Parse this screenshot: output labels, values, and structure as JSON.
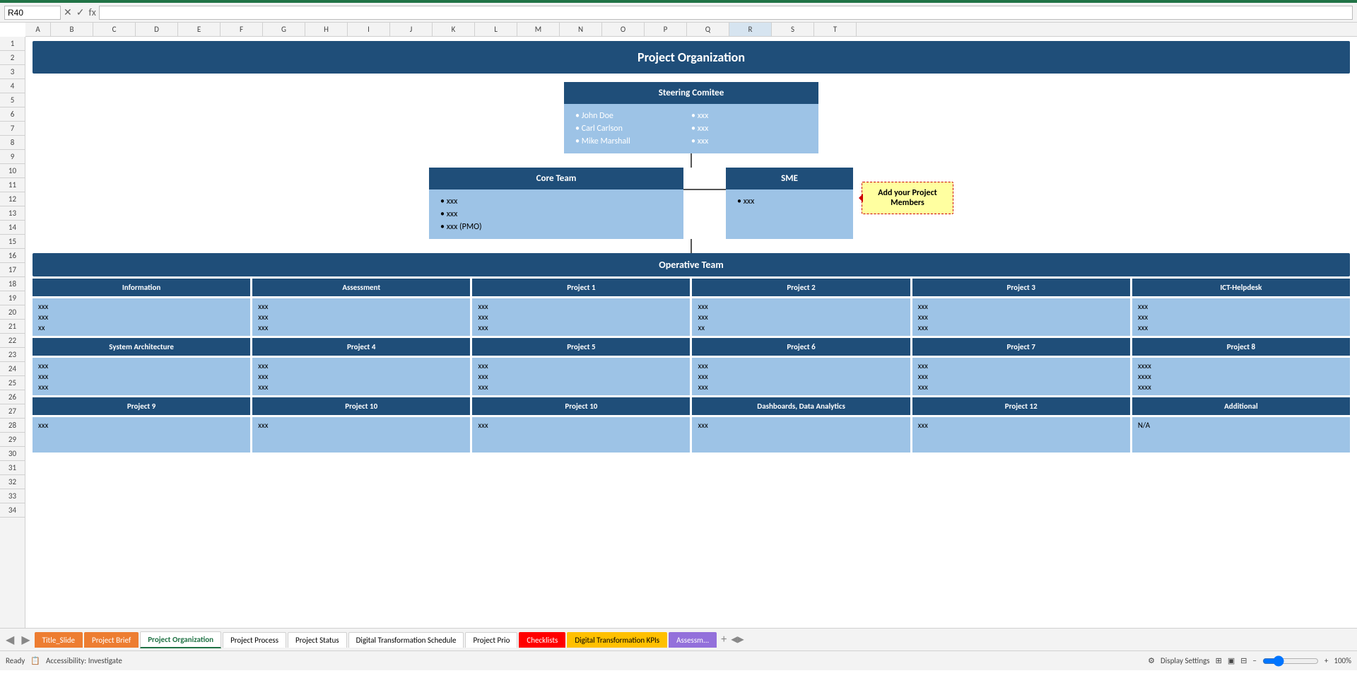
{
  "topBar": {
    "cellRef": "R40",
    "cancelIcon": "✕",
    "confirmIcon": "✓",
    "formulaIcon": "fx"
  },
  "mainHeader": "Project Organization",
  "steeringCommittee": {
    "title": "Steering Comitee",
    "leftMembers": [
      "John Doe",
      "Carl Carlson",
      "Mike Marshall"
    ],
    "rightMembers": [
      "xxx",
      "xxx",
      "xxx"
    ]
  },
  "coreTeam": {
    "title": "Core Team",
    "members": [
      "xxx",
      "xxx",
      "xxx (PMO)"
    ]
  },
  "sme": {
    "title": "SME",
    "members": [
      "xxx"
    ]
  },
  "callout": "Add your Project Members",
  "operativeTeam": {
    "title": "Operative Team"
  },
  "columns": [
    {
      "header": "Information",
      "rows": [
        {
          "items": [
            "xxx",
            "xxx",
            "xx"
          ]
        },
        {
          "header": "System Architecture",
          "items": [
            "xxx",
            "xxx",
            "xxx"
          ]
        },
        {
          "header": "Project 9",
          "items": [
            "xxx"
          ]
        }
      ]
    },
    {
      "header": "Assessment",
      "rows": [
        {
          "items": [
            "xxx",
            "xxx",
            "xxx"
          ]
        },
        {
          "header": "Project 4",
          "items": [
            "xxx",
            "xxx",
            "xxx"
          ]
        },
        {
          "header": "Project 10",
          "items": [
            "xxx"
          ]
        }
      ]
    },
    {
      "header": "Project 1",
      "rows": [
        {
          "items": [
            "xxx",
            "xxx",
            "xxx"
          ]
        },
        {
          "header": "Project 5",
          "items": [
            "xxx",
            "xxx",
            "xxx"
          ]
        },
        {
          "header": "Project 10",
          "items": [
            "xxx"
          ]
        }
      ]
    },
    {
      "header": "Project 2",
      "rows": [
        {
          "items": [
            "xxx",
            "xxx",
            "xx"
          ]
        },
        {
          "header": "Project 6",
          "items": [
            "xxx",
            "xxx",
            "xxx"
          ]
        },
        {
          "header": "Dashboards, Data Analytics",
          "items": [
            "xxx"
          ]
        }
      ]
    },
    {
      "header": "Project 3",
      "rows": [
        {
          "items": [
            "xxx",
            "xxx",
            "xxx"
          ]
        },
        {
          "header": "Project 7",
          "items": [
            "xxx",
            "xxx",
            "xxx"
          ]
        },
        {
          "header": "Project 12",
          "items": [
            "xxx"
          ]
        }
      ]
    },
    {
      "header": "ICT-Helpdesk",
      "rows": [
        {
          "items": [
            "xxx",
            "xxx",
            "xxx"
          ]
        },
        {
          "header": "Project 8",
          "items": [
            "xxxx",
            "xxxx",
            "xxxx"
          ]
        },
        {
          "header": "Additional",
          "items": [
            "N/A"
          ]
        }
      ]
    }
  ],
  "tabs": [
    {
      "label": "Title_Slide",
      "style": "orange"
    },
    {
      "label": "Project Brief",
      "style": "orange"
    },
    {
      "label": "Project Organization",
      "style": "green"
    },
    {
      "label": "Project Process",
      "style": "default"
    },
    {
      "label": "Project Status",
      "style": "default"
    },
    {
      "label": "Digital Transformation Schedule",
      "style": "default"
    },
    {
      "label": "Project Prio",
      "style": "default"
    },
    {
      "label": "Checklists",
      "style": "red"
    },
    {
      "label": "Digital Transformation KPIs",
      "style": "gold"
    },
    {
      "label": "Assessm...",
      "style": "purple"
    }
  ],
  "statusBar": {
    "ready": "Ready",
    "accessibility": "Accessibility: Investigate",
    "zoom": "100%"
  },
  "columnHeaders": [
    "A",
    "B",
    "C",
    "D",
    "E",
    "F",
    "G",
    "H",
    "I",
    "J",
    "K",
    "L",
    "M",
    "N",
    "O",
    "P",
    "Q",
    "R",
    "S",
    "T"
  ]
}
